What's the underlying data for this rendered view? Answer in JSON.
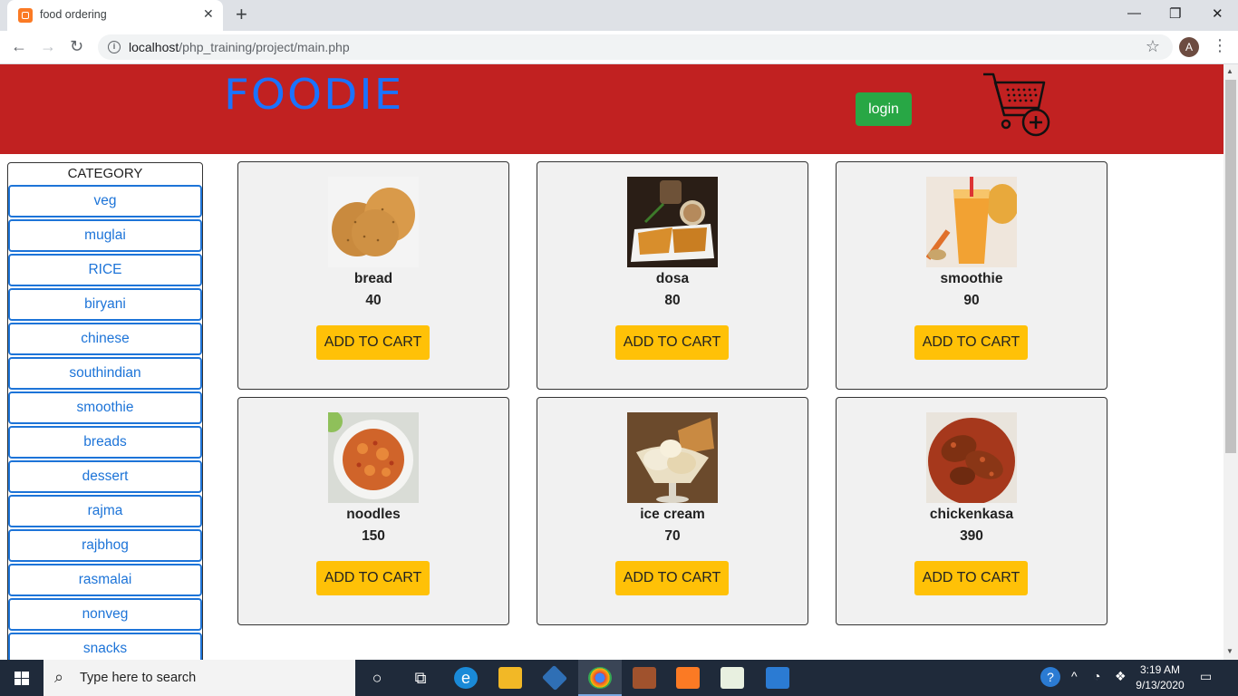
{
  "browser": {
    "tab_title": "food ordering",
    "tab_close": "✕",
    "new_tab": "+",
    "url_host": "localhost",
    "url_path": "/php_training/project/main.php",
    "avatar_letter": "A",
    "window_controls": {
      "minimize": "—",
      "restore": "❐",
      "close": "✕"
    }
  },
  "header": {
    "logo": "FOODIE",
    "login_label": "login",
    "colors": {
      "background": "#c12121",
      "logo": "#1a73ff",
      "login": "#28a745"
    }
  },
  "sidebar": {
    "title": "CATEGORY",
    "items": [
      {
        "label": "veg"
      },
      {
        "label": "muglai"
      },
      {
        "label": "RICE"
      },
      {
        "label": "biryani"
      },
      {
        "label": "chinese"
      },
      {
        "label": "southindian"
      },
      {
        "label": "smoothie"
      },
      {
        "label": "breads"
      },
      {
        "label": "dessert"
      },
      {
        "label": "rajma"
      },
      {
        "label": "rajbhog"
      },
      {
        "label": "rasmalai"
      },
      {
        "label": "nonveg"
      },
      {
        "label": "snacks"
      }
    ]
  },
  "products": [
    {
      "name": "bread",
      "price": "40",
      "button": "ADD TO CART",
      "icon": "bread-image"
    },
    {
      "name": "dosa",
      "price": "80",
      "button": "ADD TO CART",
      "icon": "dosa-image"
    },
    {
      "name": "smoothie",
      "price": "90",
      "button": "ADD TO CART",
      "icon": "smoothie-image"
    },
    {
      "name": "noodles",
      "price": "150",
      "button": "ADD TO CART",
      "icon": "noodles-image"
    },
    {
      "name": "ice cream",
      "price": "70",
      "button": "ADD TO CART",
      "icon": "ice-cream-image"
    },
    {
      "name": "chickenkasa",
      "price": "390",
      "button": "ADD TO CART",
      "icon": "chicken-image"
    }
  ],
  "taskbar": {
    "search_placeholder": "Type here to search",
    "time": "3:19 AM",
    "date": "9/13/2020"
  }
}
